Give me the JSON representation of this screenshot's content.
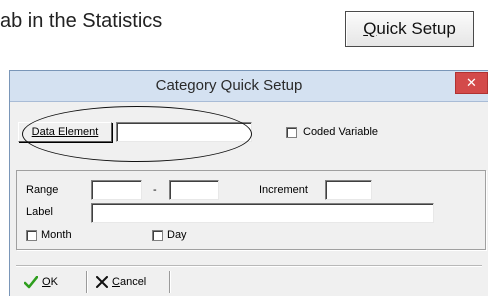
{
  "document": {
    "text_fragment": "ab in the Statistics",
    "quick_setup_button": {
      "accel": "Q",
      "rest": "uick Setup"
    }
  },
  "dialog": {
    "title": "Category Quick Setup",
    "close_glyph": "✕",
    "data_element_button": {
      "accel": "D",
      "rest": "ata Element"
    },
    "data_element_value": "",
    "coded_variable": {
      "label": "Coded Variable",
      "checked": false
    },
    "range": {
      "label": "Range",
      "dash": "-",
      "from": "",
      "to": ""
    },
    "increment": {
      "label": "Increment",
      "value": ""
    },
    "label_field": {
      "label": "Label",
      "value": ""
    },
    "month": {
      "label": "Month",
      "checked": false
    },
    "day": {
      "label": "Day",
      "checked": false
    },
    "ok_button": {
      "icon": "checkmark-icon",
      "accel": "O",
      "rest": "K",
      "icon_color": "#2e9e1e"
    },
    "cancel_button": {
      "icon": "x-icon",
      "accel": "C",
      "rest": "ancel"
    }
  },
  "colors": {
    "titlebar": "#d4e1f1",
    "close": "#d34a4a",
    "dialog_bg": "#f0f0f0"
  }
}
